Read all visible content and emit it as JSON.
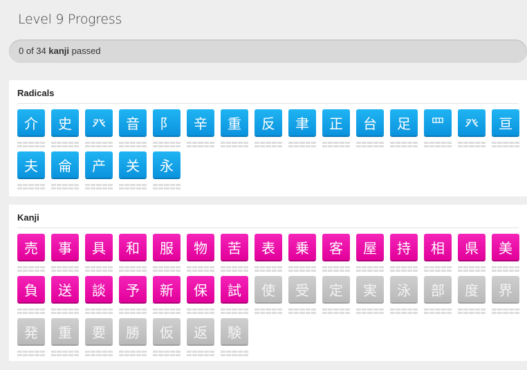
{
  "page": {
    "title": "Level 9 Progress"
  },
  "progress": {
    "passed": 0,
    "total": 34,
    "text_prefix": "0 of 34 ",
    "text_bold": "kanji",
    "text_suffix": " passed",
    "fill_fraction": 0
  },
  "radicals": {
    "header": "Radicals",
    "color": "#0a93de",
    "items": [
      "介",
      "史",
      "癶",
      "音",
      "阝",
      "辛",
      "重",
      "反",
      "聿",
      "正",
      "台",
      "足",
      "罒",
      "癶",
      "亘",
      "夫",
      "侖",
      "产",
      "关",
      "永"
    ]
  },
  "kanji": {
    "header": "Kanji",
    "unlocked_color": "#e1009a",
    "locked_color": "#bcbcbc",
    "items": [
      {
        "char": "売",
        "locked": false
      },
      {
        "char": "事",
        "locked": false
      },
      {
        "char": "具",
        "locked": false
      },
      {
        "char": "和",
        "locked": false
      },
      {
        "char": "服",
        "locked": false
      },
      {
        "char": "物",
        "locked": false
      },
      {
        "char": "苦",
        "locked": false
      },
      {
        "char": "表",
        "locked": false
      },
      {
        "char": "乗",
        "locked": false
      },
      {
        "char": "客",
        "locked": false
      },
      {
        "char": "屋",
        "locked": false
      },
      {
        "char": "持",
        "locked": false
      },
      {
        "char": "相",
        "locked": false
      },
      {
        "char": "県",
        "locked": false
      },
      {
        "char": "美",
        "locked": false
      },
      {
        "char": "負",
        "locked": false
      },
      {
        "char": "送",
        "locked": false
      },
      {
        "char": "談",
        "locked": false
      },
      {
        "char": "予",
        "locked": false
      },
      {
        "char": "新",
        "locked": false
      },
      {
        "char": "保",
        "locked": false
      },
      {
        "char": "試",
        "locked": false
      },
      {
        "char": "使",
        "locked": true
      },
      {
        "char": "受",
        "locked": true
      },
      {
        "char": "定",
        "locked": true
      },
      {
        "char": "実",
        "locked": true
      },
      {
        "char": "泳",
        "locked": true
      },
      {
        "char": "部",
        "locked": true
      },
      {
        "char": "度",
        "locked": true
      },
      {
        "char": "界",
        "locked": true
      },
      {
        "char": "発",
        "locked": true
      },
      {
        "char": "重",
        "locked": true
      },
      {
        "char": "要",
        "locked": true
      },
      {
        "char": "勝",
        "locked": true
      },
      {
        "char": "仮",
        "locked": true
      },
      {
        "char": "返",
        "locked": true
      },
      {
        "char": "験",
        "locked": true
      }
    ]
  }
}
